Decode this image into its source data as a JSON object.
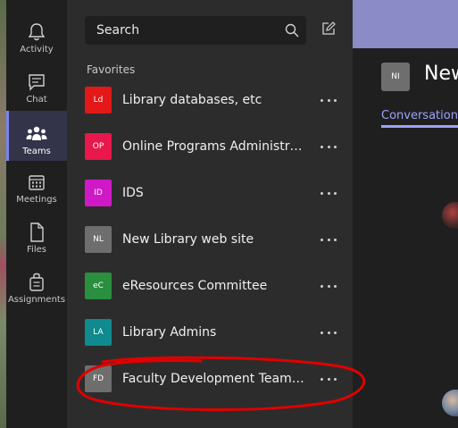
{
  "rail": {
    "items": [
      {
        "label": "Activity",
        "icon": "bell-icon"
      },
      {
        "label": "Chat",
        "icon": "chat-icon"
      },
      {
        "label": "Teams",
        "icon": "teams-icon"
      },
      {
        "label": "Meetings",
        "icon": "calendar-icon"
      },
      {
        "label": "Files",
        "icon": "file-icon"
      },
      {
        "label": "Assignments",
        "icon": "assignments-icon"
      }
    ]
  },
  "search": {
    "placeholder": "Search"
  },
  "favorites_label": "Favorites",
  "teams": [
    {
      "initials": "Ld",
      "name": "Library databases, etc",
      "color": "#e31818"
    },
    {
      "initials": "OP",
      "name": "Online Programs Administratio...",
      "color": "#e8174c"
    },
    {
      "initials": "ID",
      "name": "IDS",
      "color": "#cf19c6"
    },
    {
      "initials": "NL",
      "name": "New Library web site",
      "color": "#6e6e6e"
    },
    {
      "initials": "eC",
      "name": "eResources Committee",
      "color": "#2a8f3f"
    },
    {
      "initials": "LA",
      "name": "Library Admins",
      "color": "#0f8a8e"
    },
    {
      "initials": "FD",
      "name": "Faculty Development Team - M...",
      "color": "#6e6e6e"
    }
  ],
  "main": {
    "avatar_initials": "NI",
    "title": "New",
    "tab": "Conversations"
  },
  "colors": {
    "accent": "#7b83eb",
    "annotation": "#e00000"
  }
}
